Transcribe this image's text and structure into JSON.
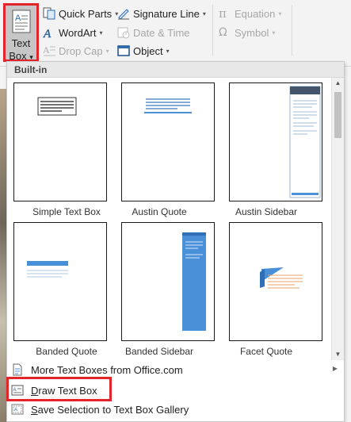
{
  "ribbon": {
    "text_box_button": {
      "line1": "Text",
      "line2": "Box",
      "dropdown": "▾",
      "icon": "text-box-icon"
    },
    "quick_parts": {
      "label": "Quick Parts",
      "icon": "quick-parts-icon"
    },
    "wordart": {
      "label": "WordArt",
      "icon": "wordart-icon"
    },
    "drop_cap": {
      "label": "Drop Cap",
      "icon": "drop-cap-icon",
      "enabled": false
    },
    "signature_line": {
      "label": "Signature Line",
      "icon": "signature-line-icon"
    },
    "date_time": {
      "label": "Date & Time",
      "icon": "date-time-icon",
      "enabled": false
    },
    "object": {
      "label": "Object",
      "icon": "object-icon"
    },
    "equation": {
      "label": "Equation",
      "icon": "pi-icon",
      "enabled": false
    },
    "symbol": {
      "label": "Symbol",
      "icon": "omega-icon",
      "enabled": false
    },
    "dropdown_glyph": "▾"
  },
  "gallery": {
    "section_label": "Built-in",
    "items": [
      {
        "label": "Simple Text Box"
      },
      {
        "label": "Austin Quote"
      },
      {
        "label": "Austin Sidebar"
      },
      {
        "label": "Banded Quote"
      },
      {
        "label": "Banded Sidebar"
      },
      {
        "label": "Facet Quote"
      }
    ]
  },
  "menu": {
    "more_text_boxes": {
      "label": "More Text Boxes from Office.com",
      "icon": "document-icon",
      "submenu_glyph": "▶"
    },
    "draw_text_box": {
      "label_u": "D",
      "label_rest": "raw Text Box",
      "icon": "draw-text-box-icon"
    },
    "save_selection": {
      "label_u": "S",
      "label_rest": "ave Selection to Text Box Gallery",
      "icon": "save-selection-icon"
    }
  },
  "scrollbar": {
    "up_glyph": "▲",
    "down_glyph": "▼"
  },
  "colors": {
    "highlight": "#e4242b",
    "accent_blue": "#4a90d9",
    "sidebar_dark": "#44546a",
    "facet_orange": "#e8a165"
  }
}
